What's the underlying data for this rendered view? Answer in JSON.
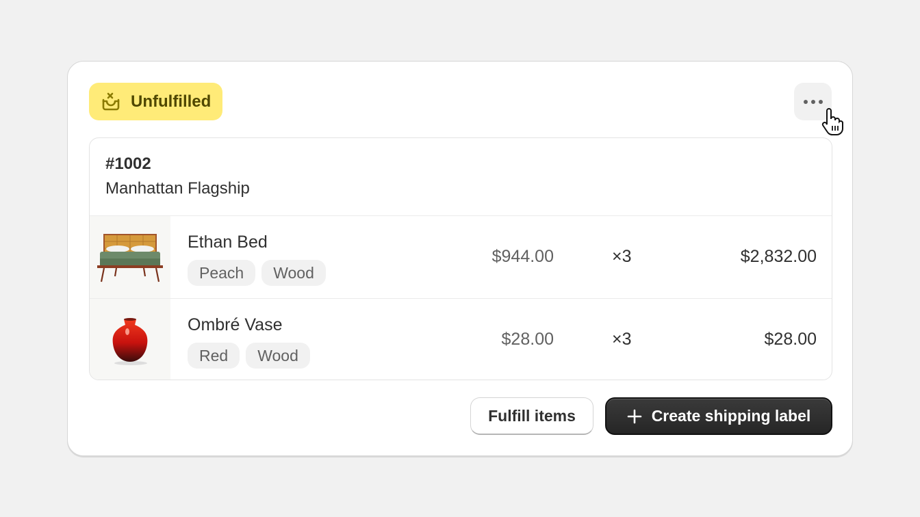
{
  "status_badge": {
    "label": "Unfulfilled",
    "icon": "package-x-icon",
    "color": "#ffeb78"
  },
  "more_actions": {
    "icon": "ellipsis-horizontal-icon"
  },
  "order": {
    "number": "#1002",
    "location": "Manhattan Flagship",
    "items": [
      {
        "name": "Ethan Bed",
        "image": "bed-image",
        "tags": [
          "Peach",
          "Wood"
        ],
        "unit_price": "$944.00",
        "quantity": "×3",
        "total": "$2,832.00"
      },
      {
        "name": "Ombré Vase",
        "image": "vase-image",
        "tags": [
          "Red",
          "Wood"
        ],
        "unit_price": "$28.00",
        "quantity": "×3",
        "total": "$28.00"
      }
    ]
  },
  "actions": {
    "fulfill_label": "Fulfill items",
    "create_label": "Create shipping label",
    "create_icon": "plus-icon"
  }
}
